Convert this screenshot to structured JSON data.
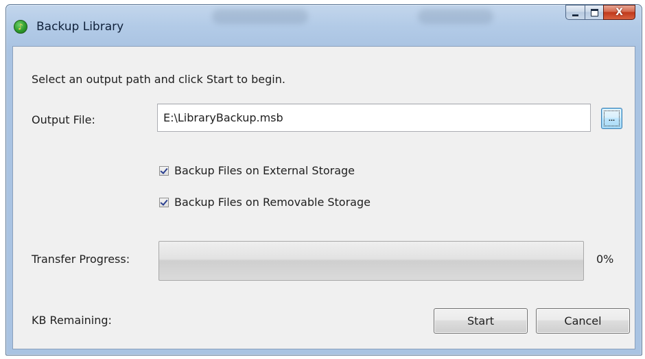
{
  "window": {
    "title": "Backup Library",
    "controls": {
      "minimize": "minimize-icon",
      "maximize": "maximize-icon",
      "close": "close-icon",
      "close_glyph": "X"
    }
  },
  "form": {
    "instruction": "Select an output path and click Start to begin.",
    "output_label": "Output File:",
    "output_value": "E:\\LibraryBackup.msb",
    "browse_label": "...",
    "options": [
      {
        "label": "Backup Files on External Storage",
        "checked": true
      },
      {
        "label": "Backup Files on Removable Storage",
        "checked": true
      }
    ],
    "progress_label": "Transfer Progress:",
    "progress_percent_text": "0%",
    "progress_value": 0,
    "kb_label": "KB Remaining:"
  },
  "buttons": {
    "start": "Start",
    "cancel": "Cancel"
  }
}
